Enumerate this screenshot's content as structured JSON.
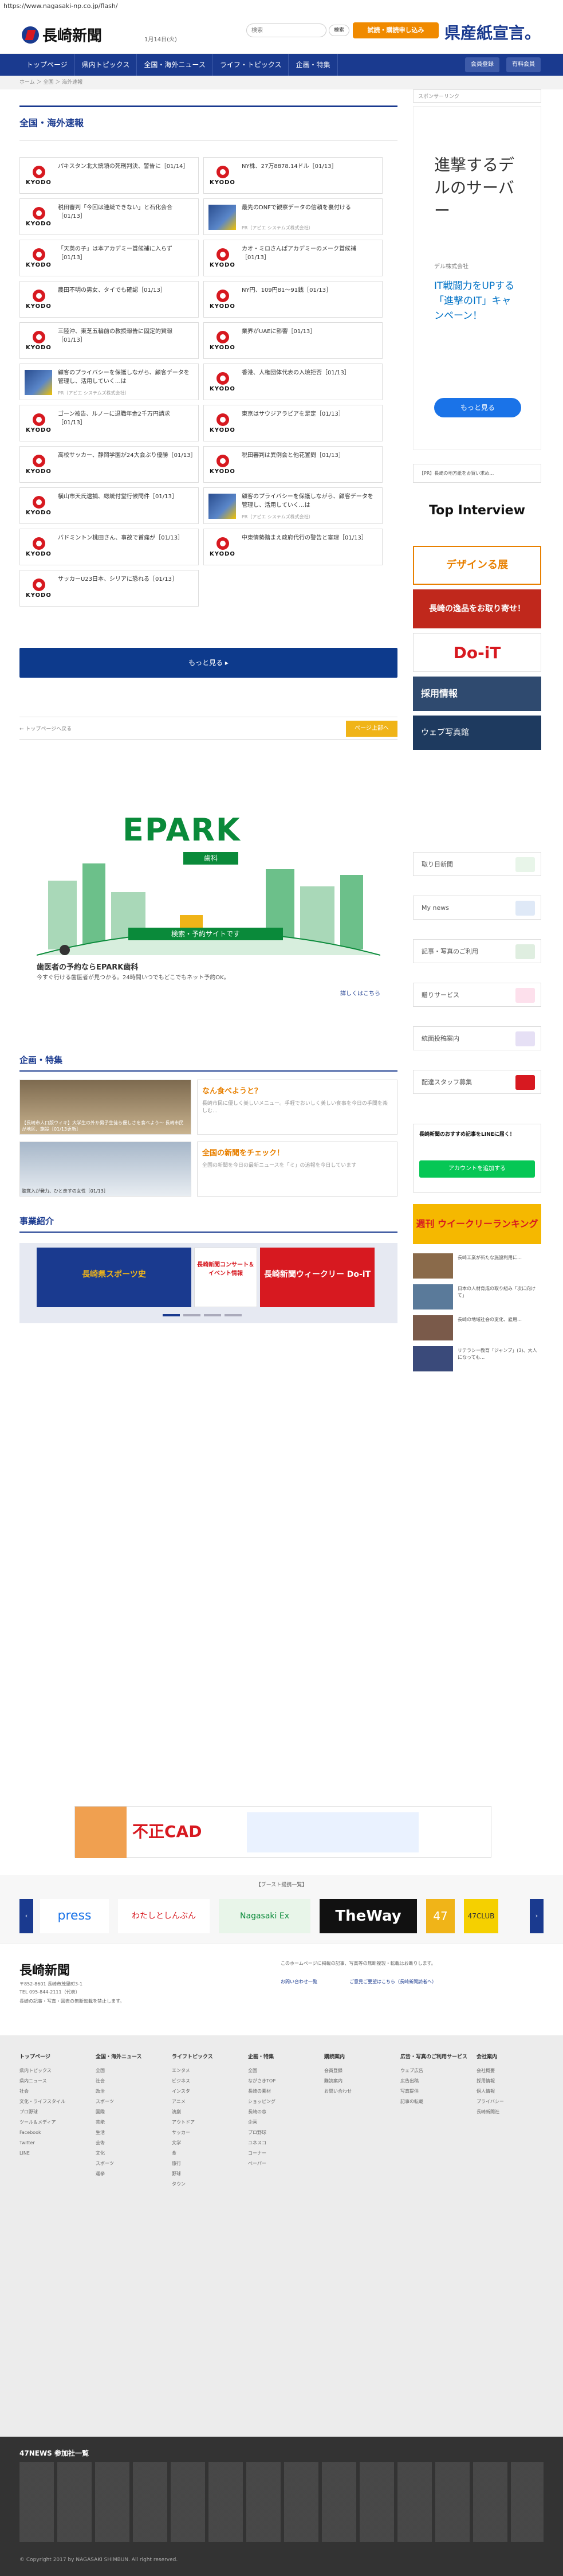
{
  "browser": {
    "url": "https://www.nagasaki-np.co.jp/flash/"
  },
  "header": {
    "logo_text": "長崎新聞",
    "date": "1月14日(火)",
    "search_placeholder": "検索",
    "search_button": "検索",
    "trial_button": "試読・購読申し込み",
    "prefecture_ad": "県産紙宣言。"
  },
  "nav": {
    "items": [
      "トップページ",
      "県内トピックス",
      "全国・海外ニュース",
      "ライフ・トピックス",
      "企画・特集"
    ],
    "right_buttons": [
      "会員登録",
      "有料会員"
    ]
  },
  "breadcrumb": "ホーム ＞ 全国 ＞ 海外速報",
  "main": {
    "section_title": "全国・海外速報",
    "cards": [
      {
        "text": "パキスタン北大統領の死刑判決、警告に［01/14］",
        "kind": "kyodo"
      },
      {
        "text": "NY株、27万8878.14ドル［01/13］",
        "kind": "kyodo"
      },
      {
        "text": "税田審判「今回は連続できない」と石化会合［01/13］",
        "kind": "kyodo"
      },
      {
        "text": "最先のDNFで観察データの信頼を裏付ける",
        "sub": "PR（アピエ システムズ株式会社）",
        "kind": "photo"
      },
      {
        "text": "「天英の子」は本アカデミー賞候補に入らず［01/13］",
        "kind": "kyodo"
      },
      {
        "text": "カオ・ミロさんぱアカデミーのメーク賞候補［01/13］",
        "kind": "kyodo"
      },
      {
        "text": "農田不明の男女、タイでも確認［01/13］",
        "kind": "kyodo"
      },
      {
        "text": "NY円、109円81〜91銭［01/13］",
        "kind": "kyodo"
      },
      {
        "text": "三陸沖、東芝五輪前の教授報告に固定的質報［01/13］",
        "kind": "kyodo"
      },
      {
        "text": "業界がUAEに影響［01/13］",
        "kind": "kyodo"
      },
      {
        "text": "顧客のプライバシーを保護しながら、顧客データを管理し、活用していく…は",
        "sub": "PR（アピエ システムズ株式会社）",
        "kind": "photo"
      },
      {
        "text": "香港、人権団体代表の入境拒否［01/13］",
        "kind": "kyodo"
      },
      {
        "text": "ゴーン被告、ルノーに退職年金2千万円請求［01/13］",
        "kind": "kyodo"
      },
      {
        "text": "東京はサウジアラビアを足定［01/13］",
        "kind": "kyodo"
      },
      {
        "text": "高校サッカー、静岡学園が24大会ぶり優勝［01/13］",
        "kind": "kyodo"
      },
      {
        "text": "税田審判は異例会と他花置問［01/13］",
        "kind": "kyodo"
      },
      {
        "text": "横山市天氏逮捕、総統付堂行候問件［01/13］",
        "kind": "kyodo"
      },
      {
        "text": "顧客のプライバシーを保護しながら、顧客データを管理し、活用していく…は",
        "sub": "PR（アピエ システムズ株式会社）",
        "kind": "photo"
      },
      {
        "text": "バドミントン桃田さん、事故で首痛が［01/13］",
        "kind": "kyodo"
      },
      {
        "text": "中東情勢踏まえ政府代行の警告と審理［01/13］",
        "kind": "kyodo"
      },
      {
        "text": "サッカーU23日本、シリアに恐れる［01/13］",
        "kind": "kyodo"
      }
    ],
    "more_button": "もっと見る ▸",
    "prev_link": "← トップページへ戻る",
    "top_button": "ページ上部へ",
    "ad_brand": "EPARK",
    "ad_brand_sub": "歯科",
    "ad_search": "検索・予約サイトです",
    "ad_title": "歯医者の予約ならEPARK歯科",
    "ad_desc": "今すぐ行ける歯医者が見つかる。24時間いつでもどこでもネット予約OK。",
    "ad_more": "詳しくはこちら",
    "feature_title": "企画・特集",
    "features": [
      {
        "caption": "【長崎市人口版ウィキ】大学生の外か男子生徒ら優しさを食べよう〜 長崎市民が地区、施設［01/13更新］",
        "head": "なん食べようと？",
        "desc": "長崎市民に優しく美しいメニュー。手軽でおいしく美しい食事を今日の手間を楽しむ…"
      },
      {
        "caption": "聴覚入が発力、ひと走すの女性［01/13］",
        "head": "全国の新聞をチェック！",
        "desc": "全国の新聞を今日の最新ニュースを「ミ」の追報を今日しています"
      }
    ],
    "business_title": "事業紹介",
    "business_banners": [
      "長崎県スポーツ史",
      "長崎新聞コンサート＆イベント情報",
      "長崎新聞ウィークリー Do-iT"
    ]
  },
  "side": {
    "sponsor_label": "スポンサーリンク",
    "ad_headline": "進撃するデルのサーバー",
    "ad_company": "デル株式会社",
    "ad_copy": "IT戦闘力をUPする「進撃のIT」キャンペーン！",
    "ad_button": "もっと見る",
    "notice": "【PR】長崎の地方紙をお買い求め…",
    "banners": [
      "Top Interview",
      "デザインる展",
      "長崎の逸品をお取り寄せ！",
      "Do-iT",
      "採用情報",
      "ウェブ写真館"
    ],
    "services": [
      "取り日新聞",
      "My news",
      "記事・写真のご利用",
      "贈りサービス",
      "統面投稿案内",
      "配達スタッフ募集"
    ],
    "line_title": "長崎新聞のおすすめ記事をLINEに届く！",
    "line_button": "アカウントを追加する",
    "weekly_title": "週刊 ウイークリーランキング",
    "weekly_items": [
      "長崎工業が新たな施設利用に…",
      "日本の人材育成の取り組み「次に向けて」",
      "長崎の地域社会の変化、雇用…",
      "リテラシー教育「ジャンプ」(3)、大人になっても…"
    ]
  },
  "footer": {
    "partner_label": "【ブースト提携一覧】",
    "partners": [
      "press",
      "わたしとしんぶん",
      "Nagasaki Ex",
      "TheWay",
      "47",
      "47CLUB"
    ],
    "logo_text": "長崎新聞",
    "address": "〒852-8601 長崎市茂里町3-1",
    "phone": "TEL 095-844-2111（代表）",
    "copy_notice": "長崎の記事・写真・図表の無断転載を禁止します。",
    "right_notice": "このホームページに掲載の記事、写真等の無断複製・転載はお断りします。",
    "right_links": [
      "お問い合わせ一覧",
      "ご意見ご要望はこちら（長崎新聞読者へ）"
    ],
    "columns": [
      {
        "title": "トップページ",
        "items": [
          "県内トピックス",
          "県内ニュース",
          "社会",
          "文化・ライフスタイル",
          "プロ野球",
          "ツール＆メディア",
          "Facebook",
          "Twitter",
          "LINE"
        ]
      },
      {
        "title": "全国・海外ニュース",
        "items": [
          "全国",
          "社会",
          "政治",
          "スポーツ",
          "国際",
          "芸能",
          "生活",
          "芸術",
          "文化",
          "スポーツ",
          "選挙"
        ]
      },
      {
        "title": "ライフトピックス",
        "items": [
          "エンタメ",
          "ビジネス",
          "インスタ",
          "アニメ",
          "演劇",
          "アウトドア",
          "サッカー",
          "文学",
          "食",
          "旅行",
          "野球",
          "タウン"
        ]
      },
      {
        "title": "企画・特集",
        "items": [
          "全国",
          "ながさきTOP",
          "長崎の素材",
          "ショッピング",
          "長崎の恋",
          "企画",
          "プロ野球",
          "ユネスコ",
          "コーナー",
          "ペーパー"
        ]
      },
      {
        "title": "購読案内",
        "items": [
          "会員登録",
          "購読案内",
          "お問い合わせ"
        ]
      },
      {
        "title": "広告・写真のご利用サービス",
        "items": [
          "ウェブ広告",
          "広告出稿",
          "写真提供",
          "記事の転載"
        ]
      },
      {
        "title": "会社案内",
        "items": [
          "会社概要",
          "採用情報",
          "個人情報",
          "プライバシー",
          "長崎新聞社"
        ]
      }
    ],
    "47news_title": "47NEWS 参加社一覧",
    "copyright": "© Copyright 2017 by NAGASAKI SHIMBUN. All right reserved."
  }
}
